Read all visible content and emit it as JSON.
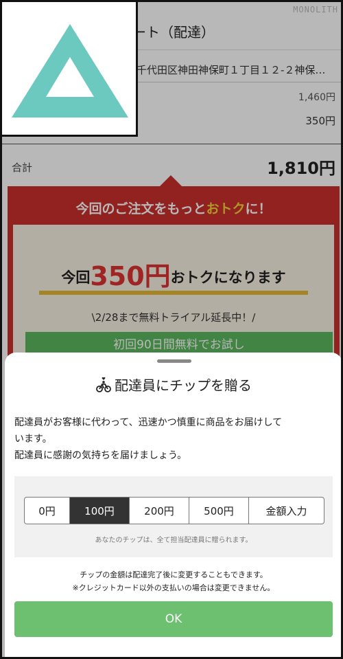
{
  "background": {
    "watermark": "MONOLITH",
    "header_title": "ート（配達）",
    "address": "千代田区神田神保町１丁目１２-２神保…",
    "partial_price": "1,460円",
    "item_price": "350円",
    "total_label": "合計",
    "total_value": "1,810円",
    "promo": {
      "heading_pre": "今回のご注文をもっと",
      "heading_accent": "おトク",
      "heading_post": "に！",
      "line_pre": "今回",
      "amount": "350円",
      "line_post": "おトクになります",
      "trial": "\\2/28まで無料トライアル延長中！/",
      "button": "初回90日間無料でお試し"
    }
  },
  "sheet": {
    "title": "配達員にチップを贈る",
    "description": [
      "配達員がお客様に代わって、迅速かつ慎重に商品をお届けして",
      "います。",
      "配達員に感謝の気持ちを届けましょう。"
    ],
    "tip_options": [
      "0円",
      "100円",
      "200円",
      "500円",
      "金額入力"
    ],
    "selected_tip": "100円",
    "tip_note": "あなたのチップは、全て担当配達員に贈られます。",
    "change_note": [
      "チップの金額は配達完了後に変更することもできます。",
      "※クレジットカード以外の支払いの場合は変更できません。"
    ],
    "ok_label": "OK"
  },
  "colors": {
    "promo_red": "#c9302c",
    "accent_yellow": "#f5d23a",
    "ok_green": "#6cc070",
    "logo_teal": "#6cc9c0",
    "selected_dark": "#333333"
  }
}
